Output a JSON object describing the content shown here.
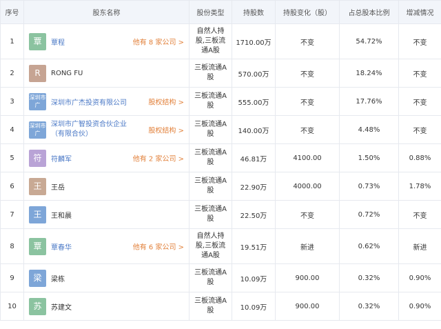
{
  "headers": [
    "序号",
    "股东名称",
    "股份类型",
    "持股数",
    "持股变化（股）",
    "占总股本比例",
    "增减情况"
  ],
  "colors": {
    "link": "#4a78c6",
    "more": "#e2803a",
    "header_bg": "#f2f5fa",
    "border": "#e6e9ef"
  },
  "rows": [
    {
      "no": "1",
      "avatar": "覃",
      "avatar_color": "#8bc3a0",
      "name": "覃程",
      "name_link": true,
      "more": "他有 8 家公司 >",
      "type": "自然人持股,三板流通A股",
      "shares": "1710.00万",
      "change": "不变",
      "ratio": "54.72%",
      "trend": "不变"
    },
    {
      "no": "2",
      "avatar": "R",
      "avatar_color": "#c6a493",
      "name": "RONG FU",
      "name_link": false,
      "more": "",
      "type": "三板流通A股",
      "shares": "570.00万",
      "change": "不变",
      "ratio": "18.24%",
      "trend": "不变"
    },
    {
      "no": "3",
      "avatar": "深圳市广",
      "avatar_color": "#7ea6d8",
      "name": "深圳市广杰投资有限公司",
      "name_link": true,
      "more": "股权结构 >",
      "type": "三板流通A股",
      "shares": "555.00万",
      "change": "不变",
      "ratio": "17.76%",
      "trend": "不变"
    },
    {
      "no": "4",
      "avatar": "深圳市广",
      "avatar_color": "#7ea6d8",
      "name": "深圳市广智投资合伙企业（有限合伙）",
      "name_link": true,
      "more": "股权结构 >",
      "type": "三板流通A股",
      "shares": "140.00万",
      "change": "不变",
      "ratio": "4.48%",
      "trend": "不变"
    },
    {
      "no": "5",
      "avatar": "符",
      "avatar_color": "#b9a3d6",
      "name": "符麟军",
      "name_link": true,
      "more": "他有 2 家公司 >",
      "type": "三板流通A股",
      "shares": "46.81万",
      "change": "4100.00",
      "ratio": "1.50%",
      "trend": "0.88%"
    },
    {
      "no": "6",
      "avatar": "王",
      "avatar_color": "#c8a994",
      "name": "王岳",
      "name_link": false,
      "more": "",
      "type": "三板流通A股",
      "shares": "22.90万",
      "change": "4000.00",
      "ratio": "0.73%",
      "trend": "1.78%"
    },
    {
      "no": "7",
      "avatar": "王",
      "avatar_color": "#7ea6d8",
      "name": "王和晨",
      "name_link": false,
      "more": "",
      "type": "三板流通A股",
      "shares": "22.50万",
      "change": "不变",
      "ratio": "0.72%",
      "trend": "不变"
    },
    {
      "no": "8",
      "avatar": "覃",
      "avatar_color": "#8bc3a0",
      "name": "覃春华",
      "name_link": true,
      "more": "他有 6 家公司 >",
      "type": "自然人持股,三板流通A股",
      "shares": "19.51万",
      "change": "新进",
      "ratio": "0.62%",
      "trend": "新进"
    },
    {
      "no": "9",
      "avatar": "梁",
      "avatar_color": "#7ea6d8",
      "name": "梁栋",
      "name_link": false,
      "more": "",
      "type": "三板流通A股",
      "shares": "10.09万",
      "change": "900.00",
      "ratio": "0.32%",
      "trend": "0.90%"
    },
    {
      "no": "10",
      "avatar": "苏",
      "avatar_color": "#8bc3a0",
      "name": "苏建文",
      "name_link": false,
      "more": "",
      "type": "三板流通A股",
      "shares": "10.09万",
      "change": "900.00",
      "ratio": "0.32%",
      "trend": "0.90%"
    }
  ]
}
